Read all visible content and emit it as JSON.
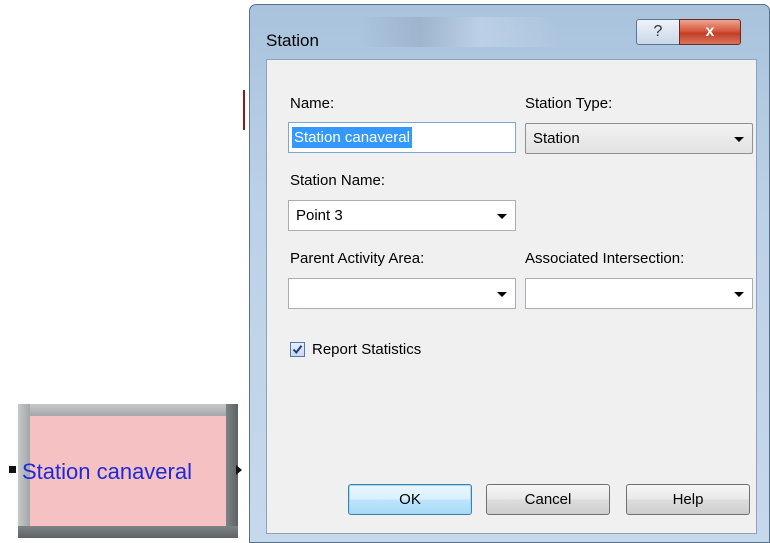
{
  "canvas": {
    "module_label": "Station canaveral"
  },
  "dialog": {
    "title": "Station",
    "help_icon": "?",
    "close_icon": "x",
    "name_label": "Name:",
    "name_value": "Station canaveral",
    "station_type_label": "Station Type:",
    "station_type_value": "Station",
    "station_name_label": "Station Name:",
    "station_name_value": "Point 3",
    "parent_activity_label": "Parent Activity Area:",
    "parent_activity_value": "",
    "assoc_intersection_label": "Associated Intersection:",
    "assoc_intersection_value": "",
    "report_statistics_label": "Report Statistics",
    "report_statistics_checked": true,
    "ok_label": "OK",
    "cancel_label": "Cancel",
    "help_label": "Help"
  },
  "colors": {
    "module_face": "#f6c1c3",
    "module_label_text": "#1a2bd8",
    "selection": "#3399ff",
    "close_button": "#c94a31"
  }
}
